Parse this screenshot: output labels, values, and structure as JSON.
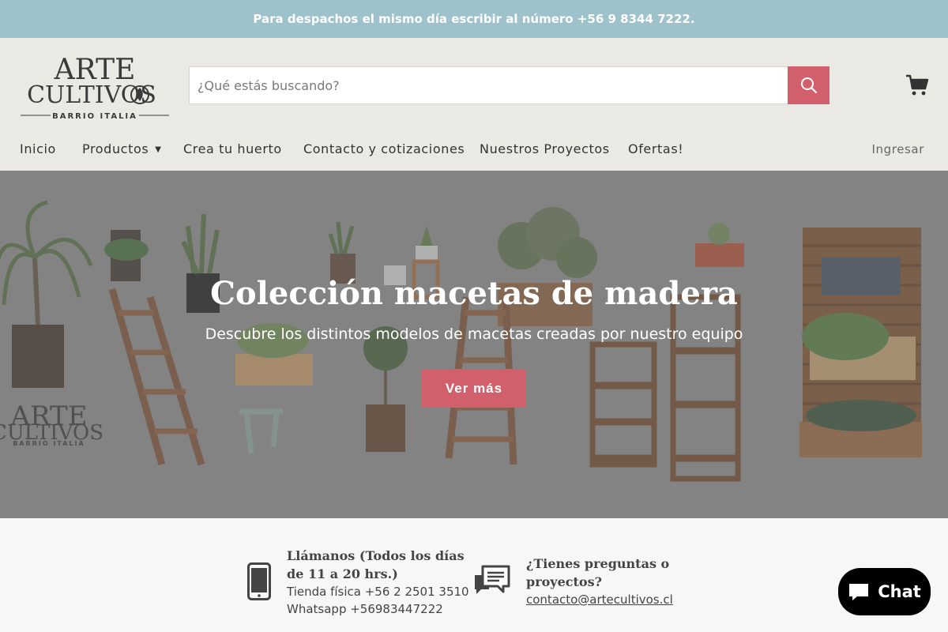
{
  "announcement": "Para despachos el mismo día escribir al número +56 9 8344 7222.",
  "logo": {
    "line1": "ARTE",
    "line2": "CULTIVOS",
    "line3": "BARRIO ITALIA"
  },
  "search": {
    "placeholder": "¿Qué estás buscando?"
  },
  "nav": {
    "items": [
      "Inicio",
      "Productos",
      "Crea tu huerto",
      "Contacto y cotizaciones",
      "Nuestros Proyectos",
      "Ofertas!"
    ],
    "login": "Ingresar"
  },
  "hero": {
    "title": "Colección macetas de madera",
    "subtitle": "Descubre los distintos modelos de macetas creadas por nuestro equipo",
    "button": "Ver más"
  },
  "info": {
    "phone": {
      "title_line1": "Llámanos (Todos los días",
      "title_line2": "de 11 a 20 hrs.)",
      "line1": "Tienda física +56 2 2501 3510",
      "line2": "Whatsapp +56983447222"
    },
    "questions": {
      "title_line1": "¿Tienes preguntas o",
      "title_line2": "proyectos?",
      "email": "contacto@artecultivos.cl"
    }
  },
  "chat": {
    "label": "Chat"
  },
  "colors": {
    "accent": "#d25f6c",
    "announce_bg": "#9ec2cb",
    "header_bg": "#ebe9e4"
  },
  "icons": [
    "search-icon",
    "cart-icon",
    "chevron-down-icon",
    "phone-icon",
    "chat-bubbles-icon",
    "chat-icon"
  ]
}
